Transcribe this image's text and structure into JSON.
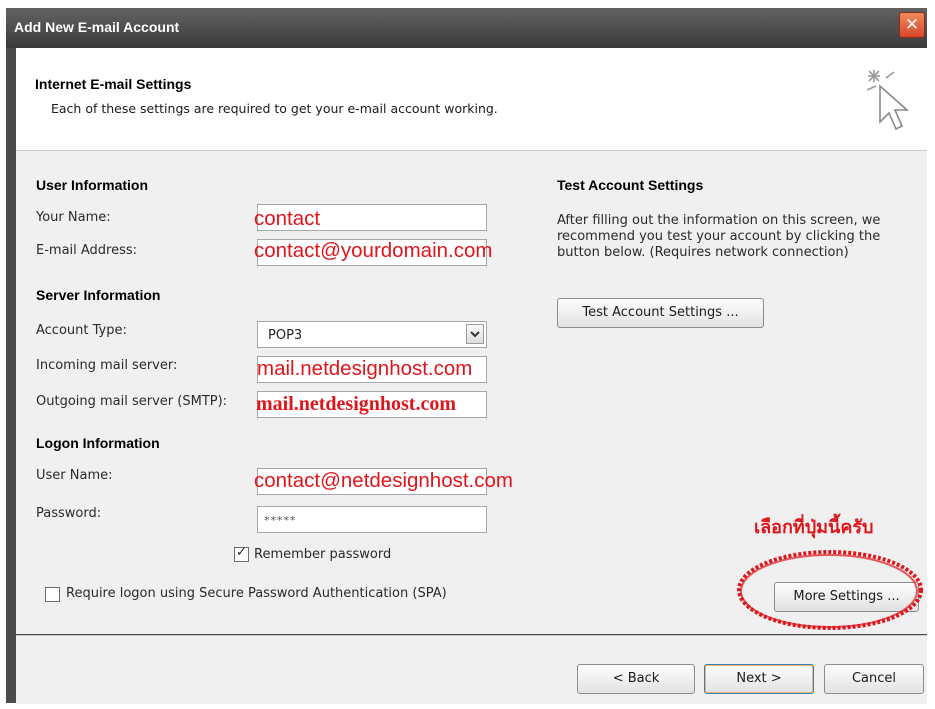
{
  "window": {
    "title": "Add New E-mail Account",
    "close_glyph": "✕"
  },
  "header": {
    "title": "Internet E-mail Settings",
    "subtitle": "Each of these settings are required to get your e-mail account working.",
    "icon": "cursor-sparkle-icon"
  },
  "user_info": {
    "heading": "User Information",
    "your_name_label": "Your Name:",
    "your_name_value": "contact",
    "email_label": "E-mail Address:",
    "email_value": "contact@yourdomain.com"
  },
  "server_info": {
    "heading": "Server Information",
    "account_type_label": "Account Type:",
    "account_type_value": "POP3",
    "incoming_label": "Incoming mail server:",
    "incoming_value": "mail.netdesignhost.com",
    "outgoing_label": "Outgoing mail server (SMTP):",
    "outgoing_value": "mail.netdesignhost.com"
  },
  "logon_info": {
    "heading": "Logon Information",
    "username_label": "User Name:",
    "username_value": "contact@netdesignhost.com",
    "password_label": "Password:",
    "password_value": "*****",
    "remember_label": "Remember password",
    "remember_checked": true,
    "spa_label": "Require logon using Secure Password Authentication (SPA)",
    "spa_checked": false
  },
  "test_settings": {
    "heading": "Test Account Settings",
    "description": "After filling out the information on this screen, we recommend you test your account by clicking the button below. (Requires network connection)",
    "test_button": "Test Account Settings ..."
  },
  "more_settings_button": "More Settings ...",
  "annotation": {
    "text": "เลือกที่ปุ่มนี้ครับ",
    "color": "#e0151b"
  },
  "footer": {
    "back": "< Back",
    "next": "Next >",
    "cancel": "Cancel"
  },
  "colors": {
    "titlebar": "#4b4b4b",
    "annotation_red": "#e0151b",
    "dialog_bg": "#f0f0f0"
  }
}
